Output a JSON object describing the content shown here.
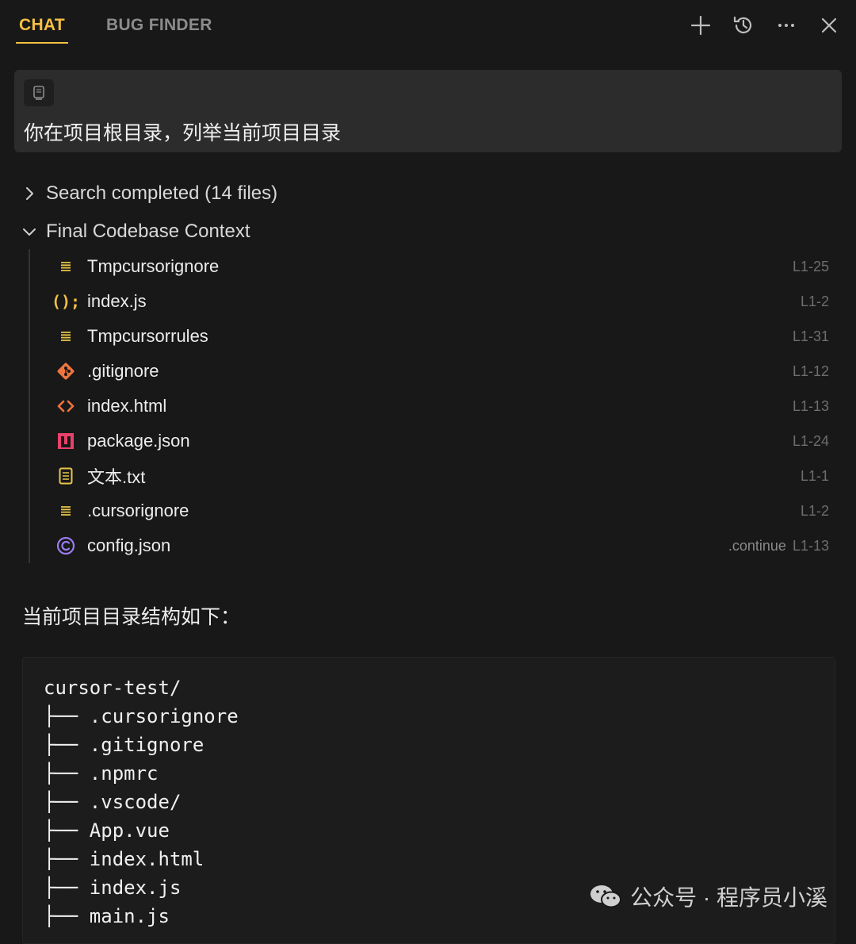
{
  "tabs": [
    {
      "label": "CHAT"
    },
    {
      "label": "BUG FINDER"
    }
  ],
  "toolbar_icons": [
    "plus-icon",
    "history-icon",
    "more-icon",
    "close-icon"
  ],
  "user_message": {
    "text": "你在项目根目录，列举当前项目目录"
  },
  "search_section": {
    "label": "Search completed (14 files)"
  },
  "context_section": {
    "label": "Final Codebase Context",
    "files": [
      {
        "name": "Tmpcursorignore",
        "range": "L1-25",
        "extra": "",
        "icon": "lines-icon"
      },
      {
        "name": "index.js",
        "range": "L1-2",
        "extra": "",
        "icon": "js-icon"
      },
      {
        "name": "Tmpcursorrules",
        "range": "L1-31",
        "extra": "",
        "icon": "lines-icon"
      },
      {
        "name": ".gitignore",
        "range": "L1-12",
        "extra": "",
        "icon": "git-icon"
      },
      {
        "name": "index.html",
        "range": "L1-13",
        "extra": "",
        "icon": "html-icon"
      },
      {
        "name": "package.json",
        "range": "L1-24",
        "extra": "",
        "icon": "npm-icon"
      },
      {
        "name": "文本.txt",
        "range": "L1-1",
        "extra": "",
        "icon": "txt-icon"
      },
      {
        "name": ".cursorignore",
        "range": "L1-2",
        "extra": "",
        "icon": "lines-icon"
      },
      {
        "name": "config.json",
        "range": "L1-13",
        "extra": ".continue",
        "icon": "continue-icon"
      }
    ]
  },
  "answer_text": "当前项目目录结构如下：",
  "code_lines": [
    "cursor-test/",
    "├── .cursorignore",
    "├── .gitignore",
    "├── .npmrc",
    "├── .vscode/",
    "├── App.vue",
    "├── index.html",
    "├── index.js",
    "├── main.js"
  ],
  "watermark": "公众号 · 程序员小溪",
  "colors": {
    "accent": "#f5c044",
    "background": "#181818",
    "message_bg": "#2c2c2c"
  }
}
